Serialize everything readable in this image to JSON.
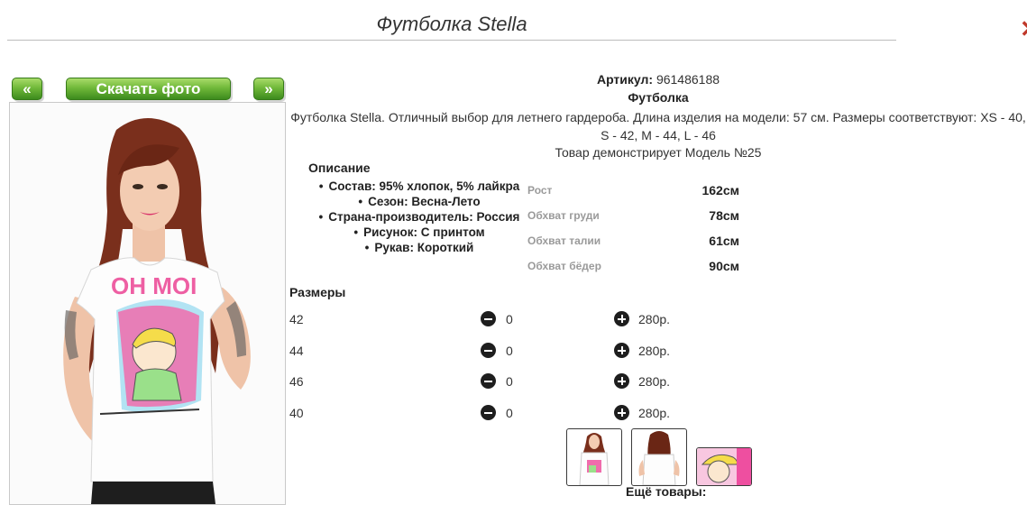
{
  "page": {
    "title": "Футболка Stella"
  },
  "nav": {
    "prev_label": "«",
    "download_label": "Скачать фото",
    "next_label": "»"
  },
  "product": {
    "article_label": "Артикул:",
    "article_value": "961486188",
    "kind": "Футболка",
    "description": "Футболка Stella. Отличный выбор для летнего гардероба. Длина изделия на модели: 57 см. Размеры соответствуют: XS - 40, S - 42, M - 44, L - 46",
    "model_note": "Товар демонстрирует Модель №25"
  },
  "description_section": {
    "heading": "Описание",
    "features": [
      "Состав: 95% хлопок, 5% лайкра",
      "Сезон: Весна-Лето",
      "Страна-производитель: Россия",
      "Рисунок: С принтом",
      "Рукав: Короткий"
    ]
  },
  "model_params": [
    {
      "name": "Рост",
      "value": "162см"
    },
    {
      "name": "Обхват груди",
      "value": "78см"
    },
    {
      "name": "Обхват талии",
      "value": "61см"
    },
    {
      "name": "Обхват бёдер",
      "value": "90см"
    }
  ],
  "sizes": {
    "heading": "Размеры",
    "rows": [
      {
        "size": "42",
        "qty": "0",
        "price": "280р."
      },
      {
        "size": "44",
        "qty": "0",
        "price": "280р."
      },
      {
        "size": "46",
        "qty": "0",
        "price": "280р."
      },
      {
        "size": "40",
        "qty": "0",
        "price": "280р."
      }
    ]
  },
  "print_text": "OH MOI",
  "more_label": "Ещё товары:",
  "colors": {
    "button_green": "#5aa92c",
    "print_pink": "#ee4fa0",
    "print_blue": "#7ed3ef"
  }
}
